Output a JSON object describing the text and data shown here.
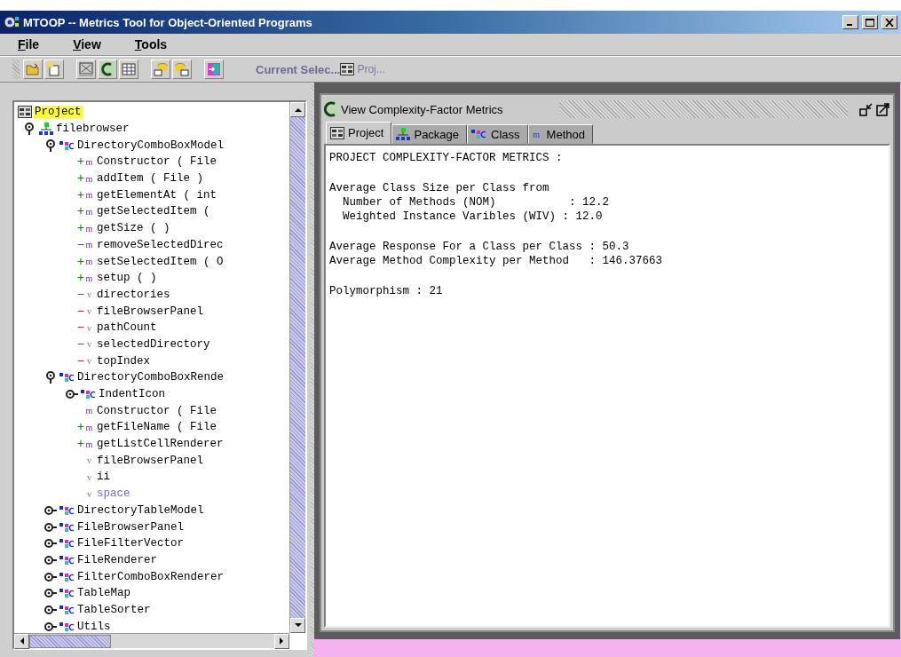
{
  "window": {
    "title": "MTOOP -- Metrics Tool for Object-Oriented Programs"
  },
  "menu": [
    "File",
    "View",
    "Tools"
  ],
  "current_selection": {
    "label": "Current Selec...",
    "value": "Proj..."
  },
  "tree": [
    {
      "kind": "project",
      "label": "Project",
      "selected": true,
      "children": [
        {
          "kind": "package",
          "label": "filebrowser",
          "selected": false,
          "expanded": true,
          "children": [
            {
              "kind": "class",
              "label": "DirectoryComboBoxModel",
              "selected": false,
              "expanded": true,
              "children": [
                {
                  "kind": "method",
                  "sign": "+",
                  "color": "#1a7a1a",
                  "badge": "m",
                  "label": "Constructor  ( File",
                  "selected": false
                },
                {
                  "kind": "method",
                  "sign": "+",
                  "color": "#1a7a1a",
                  "badge": "m",
                  "label": "addItem ( File )",
                  "selected": false
                },
                {
                  "kind": "method",
                  "sign": "+",
                  "color": "#1a7a1a",
                  "badge": "m",
                  "label": "getElementAt ( int",
                  "selected": false
                },
                {
                  "kind": "method",
                  "sign": "+",
                  "color": "#1a7a1a",
                  "badge": "m",
                  "label": "getSelectedItem (",
                  "selected": false
                },
                {
                  "kind": "method",
                  "sign": "+",
                  "color": "#1a7a1a",
                  "badge": "m",
                  "label": "getSize (  )",
                  "selected": false
                },
                {
                  "kind": "method",
                  "sign": "−",
                  "color": "#a03030",
                  "badge": "m",
                  "label": "removeSelectedDirec",
                  "selected": false
                },
                {
                  "kind": "method",
                  "sign": "+",
                  "color": "#1a7a1a",
                  "badge": "m",
                  "label": "setSelectedItem ( O",
                  "selected": false
                },
                {
                  "kind": "method",
                  "sign": "+",
                  "color": "#1a7a1a",
                  "badge": "m",
                  "label": "setup (  )",
                  "selected": false
                },
                {
                  "kind": "variable",
                  "sign": "−",
                  "color": "#a03030",
                  "badge": "v",
                  "label": "directories",
                  "selected": false
                },
                {
                  "kind": "variable",
                  "sign": "−",
                  "color": "#a03030",
                  "badge": "v",
                  "label": "fileBrowserPanel",
                  "selected": false
                },
                {
                  "kind": "variable",
                  "sign": "−",
                  "color": "#a03030",
                  "badge": "v",
                  "label": "pathCount",
                  "selected": false
                },
                {
                  "kind": "variable",
                  "sign": "−",
                  "color": "#a03030",
                  "badge": "v",
                  "label": "selectedDirectory",
                  "selected": false
                },
                {
                  "kind": "variable",
                  "sign": "−",
                  "color": "#a03030",
                  "badge": "v",
                  "label": "topIndex",
                  "selected": false
                }
              ]
            },
            {
              "kind": "class",
              "label": "DirectoryComboBoxRende",
              "selected": false,
              "expanded": true,
              "children": [
                {
                  "kind": "class",
                  "label": "IndentIcon",
                  "selected": false,
                  "expanded": false
                },
                {
                  "kind": "method",
                  "badge": "m",
                  "label": "Constructor  ( File",
                  "selected": false
                },
                {
                  "kind": "method",
                  "sign": "+",
                  "color": "#1a7a1a",
                  "badge": "m",
                  "label": "getFileName ( File",
                  "selected": false
                },
                {
                  "kind": "method",
                  "sign": "+",
                  "color": "#1a7a1a",
                  "badge": "m",
                  "label": "getListCellRenderer",
                  "selected": false
                },
                {
                  "kind": "variable",
                  "badge": "v",
                  "label": "fileBrowserPanel",
                  "selected": false
                },
                {
                  "kind": "variable",
                  "badge": "v",
                  "label": "ii",
                  "selected": false
                },
                {
                  "kind": "variable",
                  "badge": "v",
                  "label": "space",
                  "selected": false,
                  "dimmed": true
                }
              ]
            },
            {
              "kind": "class",
              "label": "DirectoryTableModel",
              "selected": false,
              "expanded": false
            },
            {
              "kind": "class",
              "label": "FileBrowserPanel",
              "selected": false,
              "expanded": false
            },
            {
              "kind": "class",
              "label": "FileFilterVector",
              "selected": false,
              "expanded": false
            },
            {
              "kind": "class",
              "label": "FileRenderer",
              "selected": false,
              "expanded": false
            },
            {
              "kind": "class",
              "label": "FilterComboBoxRenderer",
              "selected": false,
              "expanded": false
            },
            {
              "kind": "class",
              "label": "TableMap",
              "selected": false,
              "expanded": false
            },
            {
              "kind": "class",
              "label": "TableSorter",
              "selected": false,
              "expanded": false
            },
            {
              "kind": "class",
              "label": "Utils",
              "selected": false,
              "expanded": false
            }
          ]
        }
      ]
    }
  ],
  "metrics_window": {
    "title": "View Complexity-Factor Metrics",
    "tabs": [
      {
        "kind": "project",
        "label": "Project",
        "selected": true
      },
      {
        "kind": "package",
        "label": "Package",
        "selected": false
      },
      {
        "kind": "class",
        "label": "Class",
        "selected": false
      },
      {
        "kind": "method",
        "label": "Method",
        "selected": false,
        "badge": "m"
      }
    ],
    "report": [
      [
        "PROJECT COMPLEXITY-FACTOR METRICS :"
      ],
      [
        "Average Class Size per Class from",
        "  Number of Methods (NOM)           : 12.2",
        "  Weighted Instance Varibles (WIV) : 12.0"
      ],
      [
        "Average Response For a Class per Class : 50.3",
        "Average Method Complexity per Method   : 146.37663"
      ],
      [
        "Polymorphism : 21"
      ]
    ]
  }
}
